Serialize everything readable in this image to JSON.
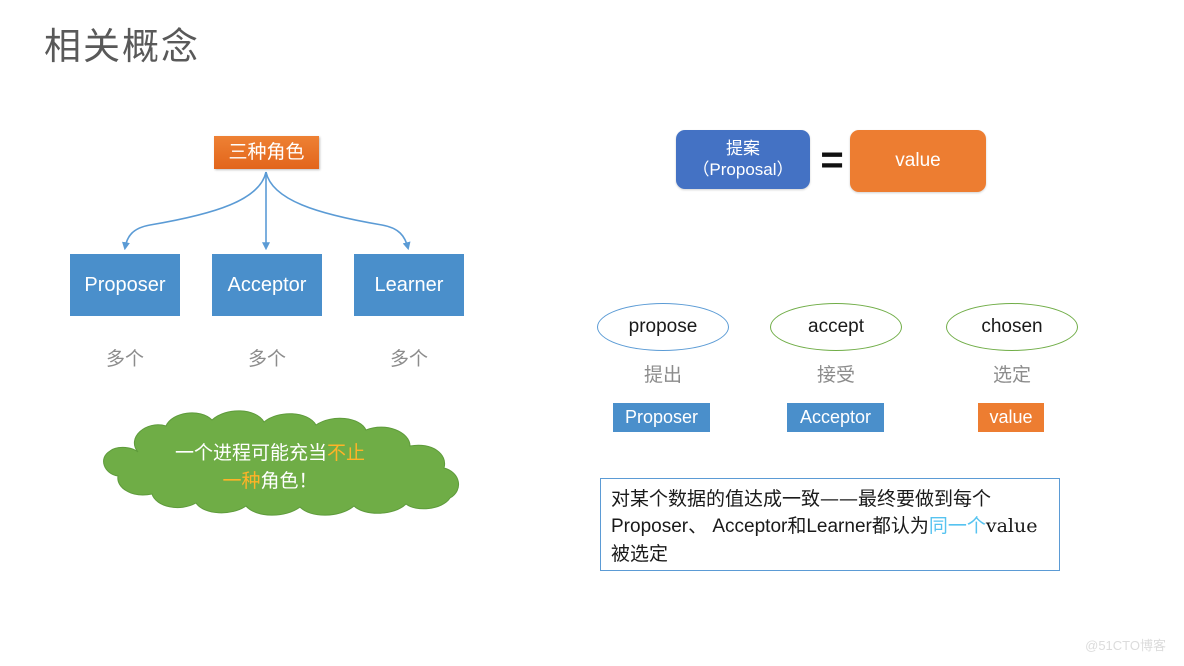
{
  "slide": {
    "title": "相关概念",
    "background": "#ffffff",
    "watermark": "@51CTO博客"
  },
  "roles_diagram": {
    "header_label": "三种角色",
    "header_color": "#E8702A",
    "box_color": "#4A8FCB",
    "arrow_color": "#5B9BD5",
    "roles": [
      {
        "name": "Proposer",
        "count_label": "多个"
      },
      {
        "name": "Acceptor",
        "count_label": "多个"
      },
      {
        "name": "Learner",
        "count_label": "多个"
      }
    ]
  },
  "cloud": {
    "fill_color": "#6FAD46",
    "line1_plain": "一个进程可能充当",
    "line1_highlight": "不止",
    "line2_highlight": "一种",
    "line2_plain": "角色！",
    "highlight_color": "#FFB327"
  },
  "equation": {
    "left_line1": "提案",
    "left_line2": "（Proposal）",
    "left_color": "#4472C4",
    "operator": "=",
    "right_label": "value",
    "right_color": "#ED7D31"
  },
  "stages": [
    {
      "term": "propose",
      "ellipse_color": "#5B9BD5",
      "cn_label": "提出",
      "chip_label": "Proposer",
      "chip_color": "#4A8FCB"
    },
    {
      "term": "accept",
      "ellipse_color": "#70AD47",
      "cn_label": "接受",
      "chip_label": "Acceptor",
      "chip_color": "#4A8FCB"
    },
    {
      "term": "chosen",
      "ellipse_color": "#70AD47",
      "cn_label": "选定",
      "chip_label": "value",
      "chip_color": "#ED7D31"
    }
  ],
  "note": {
    "border_color": "#5B9BD5",
    "seg1": "对某个数据的值达成一致——最终要做到每个",
    "seg2": "Proposer、 Acceptor和Learner都认为",
    "seg3_highlight": "同一个",
    "seg4": "value被选定",
    "highlight_color": "#56C3F0"
  }
}
